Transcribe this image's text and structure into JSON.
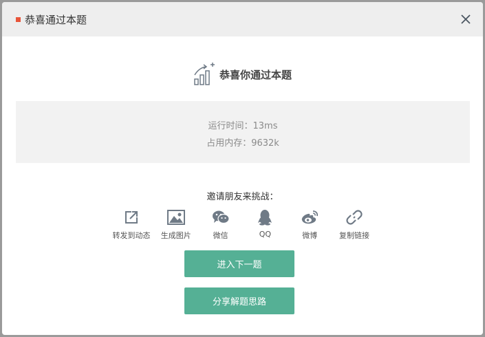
{
  "modal": {
    "title": "恭喜通过本题",
    "hero_title": "恭喜你通过本题"
  },
  "stats": {
    "runtime": "运行时间：13ms",
    "memory": "占用内存：9632k"
  },
  "invite": {
    "label": "邀请朋友来挑战：",
    "items": [
      {
        "label": "转发到动态",
        "icon": "share-out-icon"
      },
      {
        "label": "生成图片",
        "icon": "image-icon"
      },
      {
        "label": "微信",
        "icon": "wechat-icon"
      },
      {
        "label": "QQ",
        "icon": "qq-icon"
      },
      {
        "label": "微博",
        "icon": "weibo-icon"
      },
      {
        "label": "复制链接",
        "icon": "link-icon"
      }
    ]
  },
  "buttons": {
    "next": "进入下一题",
    "share": "分享解题思路"
  },
  "colors": {
    "accent": "#55b095",
    "marker": "#e8553a",
    "icon": "#6f7a86"
  }
}
